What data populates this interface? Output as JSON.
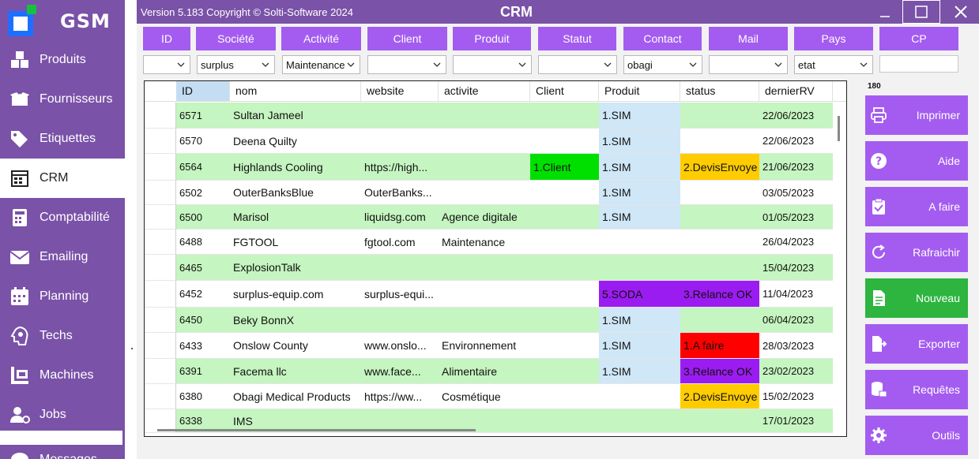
{
  "app": {
    "version_text": "Version 5.183  Copyright © Solti-Software 2024",
    "title": "CRM",
    "logo_text": "GSM"
  },
  "sidebar": {
    "items": [
      {
        "label": "Produits",
        "icon": "boxes-icon"
      },
      {
        "label": "Fournisseurs",
        "icon": "box-open-icon"
      },
      {
        "label": "Etiquettes",
        "icon": "tags-icon"
      },
      {
        "label": "CRM",
        "icon": "calendar-grid-icon"
      },
      {
        "label": "Comptabilité",
        "icon": "calculator-icon"
      },
      {
        "label": "Emailing",
        "icon": "envelope-icon"
      },
      {
        "label": "Planning",
        "icon": "calendar-icon"
      },
      {
        "label": "Techs",
        "icon": "gear-head-icon"
      },
      {
        "label": "Machines",
        "icon": "machines-icon"
      },
      {
        "label": "Jobs",
        "icon": "user-gear-icon"
      },
      {
        "label": "Messages",
        "icon": "message-icon"
      }
    ],
    "active": "CRM"
  },
  "filters": [
    {
      "label": "ID",
      "value": ""
    },
    {
      "label": "Société",
      "value": "surplus"
    },
    {
      "label": "Activité",
      "value": "Maintenance"
    },
    {
      "label": "Client",
      "value": ""
    },
    {
      "label": "Produit",
      "value": ""
    },
    {
      "label": "Statut",
      "value": ""
    },
    {
      "label": "Contact",
      "value": "obagi"
    },
    {
      "label": "Mail",
      "value": ""
    },
    {
      "label": "Pays",
      "value": "etat"
    },
    {
      "label": "CP",
      "value": ""
    }
  ],
  "grid": {
    "columns": [
      "ID",
      "nom",
      "website",
      "activite",
      "Client",
      "Produit",
      "status",
      "dernierRV"
    ],
    "rows": [
      {
        "id": "6571",
        "nom": "Sultan Jameel",
        "website": "",
        "activite": "",
        "client": "",
        "produit": "1.SIM",
        "status": "",
        "date": "22/06/2023"
      },
      {
        "id": "6570",
        "nom": "Deena Quilty",
        "website": "",
        "activite": "",
        "client": "",
        "produit": "1.SIM",
        "status": "",
        "date": "22/06/2023"
      },
      {
        "id": "6564",
        "nom": "Highlands Cooling",
        "website": "https://high...",
        "activite": "",
        "client": "1.Client",
        "produit": "1.SIM",
        "status": "2.DevisEnvoye",
        "date": "21/06/2023"
      },
      {
        "id": "6502",
        "nom": "OuterBanksBlue",
        "website": "OuterBanks...",
        "activite": "",
        "client": "",
        "produit": "1.SIM",
        "status": "",
        "date": "03/05/2023"
      },
      {
        "id": "6500",
        "nom": "Marisol",
        "website": "liquidsg.com",
        "activite": "Agence digitale",
        "client": "",
        "produit": "1.SIM",
        "status": "",
        "date": "01/05/2023"
      },
      {
        "id": "6488",
        "nom": "FGTOOL",
        "website": "fgtool.com",
        "activite": "Maintenance",
        "client": "",
        "produit": "",
        "status": "",
        "date": "26/04/2023"
      },
      {
        "id": "6465",
        "nom": "ExplosionTalk",
        "website": "",
        "activite": "",
        "client": "",
        "produit": "",
        "status": "",
        "date": "15/04/2023"
      },
      {
        "id": "6452",
        "nom": "surplus-equip.com",
        "website": "surplus-equi...",
        "activite": "",
        "client": "",
        "produit": "5.SODA",
        "status": "3.Relance OK",
        "date": "11/04/2023"
      },
      {
        "id": "6450",
        "nom": "Beky BonnX",
        "website": "",
        "activite": "",
        "client": "",
        "produit": "1.SIM",
        "status": "",
        "date": "06/04/2023"
      },
      {
        "id": "6433",
        "nom": "Onslow County",
        "website": "www.onslo...",
        "activite": "Environnement",
        "client": "",
        "produit": "1.SIM",
        "status": "1.A faire",
        "date": "28/03/2023"
      },
      {
        "id": "6391",
        "nom": "Facema llc",
        "website": "www.face...",
        "activite": "Alimentaire",
        "client": "",
        "produit": "1.SIM",
        "status": "3.Relance OK",
        "date": "23/02/2023"
      },
      {
        "id": "6380",
        "nom": "Obagi Medical Products",
        "website": "https://ww...",
        "activite": "Cosmétique",
        "client": "",
        "produit": "",
        "status": "2.DevisEnvoye",
        "date": "15/02/2023"
      },
      {
        "id": "6338",
        "nom": "IMS",
        "website": "",
        "activite": "",
        "client": "",
        "produit": "",
        "status": "",
        "date": "17/01/2023"
      }
    ]
  },
  "record_count": "180",
  "actions": [
    {
      "label": "Imprimer",
      "icon": "printer-icon"
    },
    {
      "label": "Aide",
      "icon": "help-icon"
    },
    {
      "label": "A faire",
      "icon": "clipboard-check-icon"
    },
    {
      "label": "Rafraichir",
      "icon": "refresh-icon"
    },
    {
      "label": "Nouveau",
      "icon": "new-document-icon"
    },
    {
      "label": "Exporter",
      "icon": "export-icon"
    },
    {
      "label": "Requêtes",
      "icon": "database-icon"
    },
    {
      "label": "Outils",
      "icon": "gear-icon"
    }
  ],
  "colors": {
    "sidebar": "#7a52a8",
    "accent": "#a45cf0",
    "row_green": "#c5f5c0",
    "produit_blue": "#cfe7f7",
    "client_green": "#00e000",
    "status_yellow": "#ffcc00",
    "status_purple": "#9b1cf0",
    "status_red": "#ff0000",
    "nouveau_green": "#2db53f"
  }
}
